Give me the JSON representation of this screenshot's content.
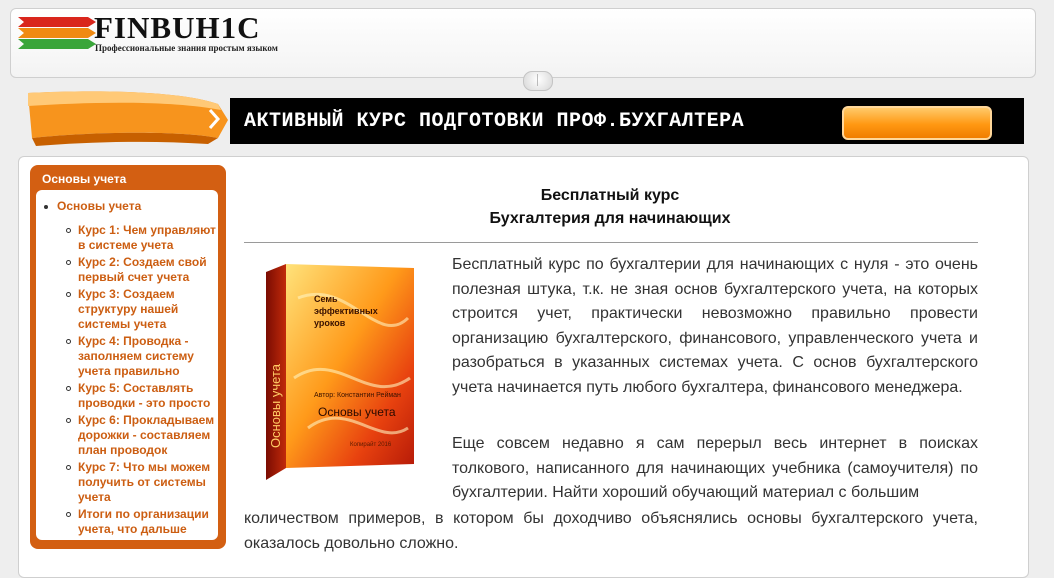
{
  "header": {
    "logo_title": "FINBUH1C",
    "logo_subtitle": "Профессиональные знания простым языком"
  },
  "banner": {
    "text": "АКТИВНЫЙ КУРС ПОДГОТОВКИ ПРОФ.БУХГАЛТЕРА"
  },
  "sidebar": {
    "title": "Основы учета",
    "root_link": "Основы учета",
    "items": [
      {
        "label": "Курс 1: Чем управляют в системе учета"
      },
      {
        "label": "Курс 2: Создаем свой первый счет учета"
      },
      {
        "label": "Курс 3: Создаем структуру нашей системы учета"
      },
      {
        "label": "Курс 4: Проводка - заполняем систему учета правильно"
      },
      {
        "label": "Курс 5: Составлять проводки - это просто"
      },
      {
        "label": "Курс 6: Прокладываем дорожки - составляем план проводок"
      },
      {
        "label": "Курс 7: Что мы можем получить от системы учета"
      },
      {
        "label": "Итоги по организации учета, что дальше"
      }
    ]
  },
  "article": {
    "title_line1": "Бесплатный курс",
    "title_line2": "Бухгалтерия для начинающих",
    "book": {
      "cover_line1": "Семь",
      "cover_line2": "эффективных",
      "cover_line3": "уроков",
      "author": "Автор: Константин Рейман",
      "cover_title": "Основы учета",
      "spine_title": "Основы учета",
      "footer": "Копирайт 2016"
    },
    "paragraph1": "Бесплатный курс по бухгалтерии для начинающих с нуля - это очень полезная штука, т.к. не зная основ бухгалтерского учета, на которых строится учет, практически невозможно правильно провести организацию бухгалтерского, финансового, управленческого учета и разобраться в указанных системах учета. С основ бухгалтерского учета начинается путь любого бухгалтера, финансового менеджера.",
    "paragraph2_part1": "Еще совсем недавно я сам перерыл весь интернет в поисках толкового, написанного для начинающих учебника (самоучителя) по бухгалтерии. Найти хороший обучающий материал с большим",
    "paragraph2_part2": "количеством примеров, в котором бы доходчиво объяснялись основы бухгалтерского учета, оказалось довольно сложно."
  },
  "colors": {
    "accent_orange": "#d35f12",
    "link_orange": "#cc5e12",
    "banner_black": "#000000"
  }
}
